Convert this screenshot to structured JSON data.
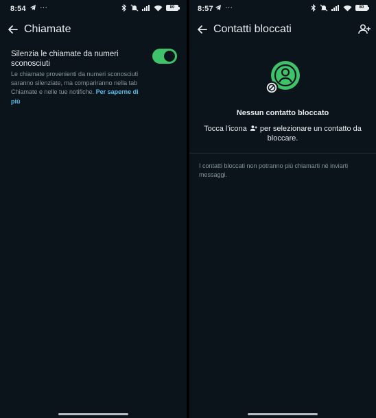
{
  "left": {
    "status": {
      "time": "8:54",
      "battery": "80",
      "notification_icon": "telegram-icon"
    },
    "title": "Chiamate",
    "setting": {
      "title": "Silenzia le chiamate da numeri sconosciuti",
      "description": "Le chiamate provenienti da numeri sconosciuti saranno silenziate, ma compariranno nella tab Chiamate e nelle tue notifiche.",
      "link": "Per saperne di più",
      "enabled": true,
      "accent": "#3ec26a"
    }
  },
  "right": {
    "status": {
      "time": "8:57",
      "battery": "80",
      "notification_icon": "telegram-icon"
    },
    "title": "Contatti bloccati",
    "empty": {
      "title": "Nessun contatto bloccato",
      "text_before": "Tocca l'icona",
      "text_after": "per selezionare un contatto da bloccare."
    },
    "footnote": "I contatti bloccati non potranno più chiamarti né inviarti messaggi."
  },
  "colors": {
    "background": "#0b141a",
    "text": "#e9edef",
    "muted": "#8696a0",
    "link": "#53bdeb"
  }
}
